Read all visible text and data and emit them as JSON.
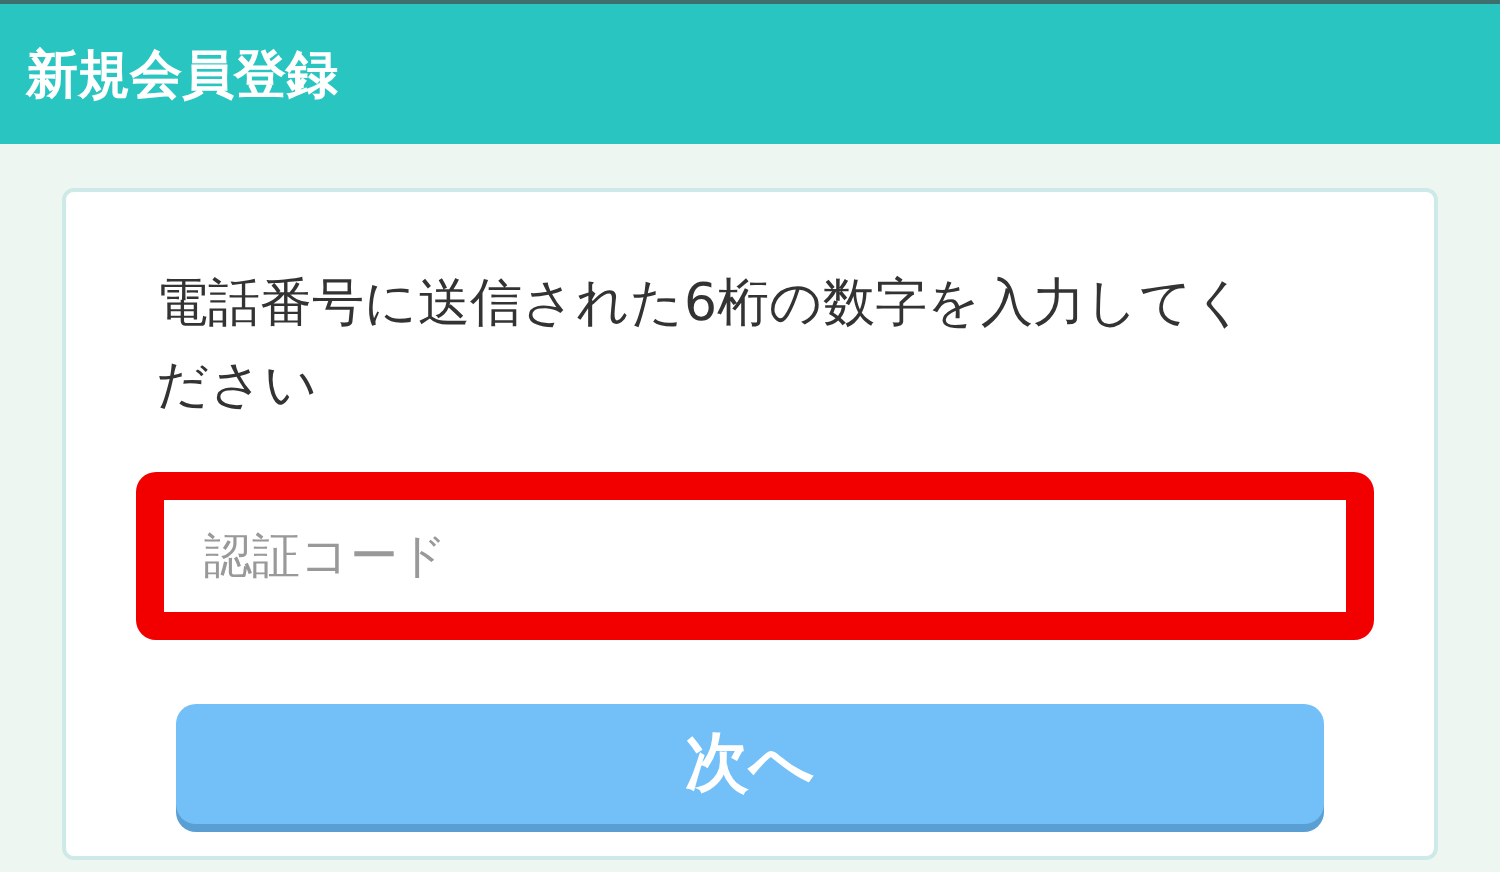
{
  "header": {
    "title": "新規会員登録"
  },
  "form": {
    "instruction": "電話番号に送信された6桁の数字を入力してください",
    "code_field": {
      "placeholder": "認証コード",
      "highlighted": true
    },
    "next_button": {
      "label": "次へ"
    }
  }
}
